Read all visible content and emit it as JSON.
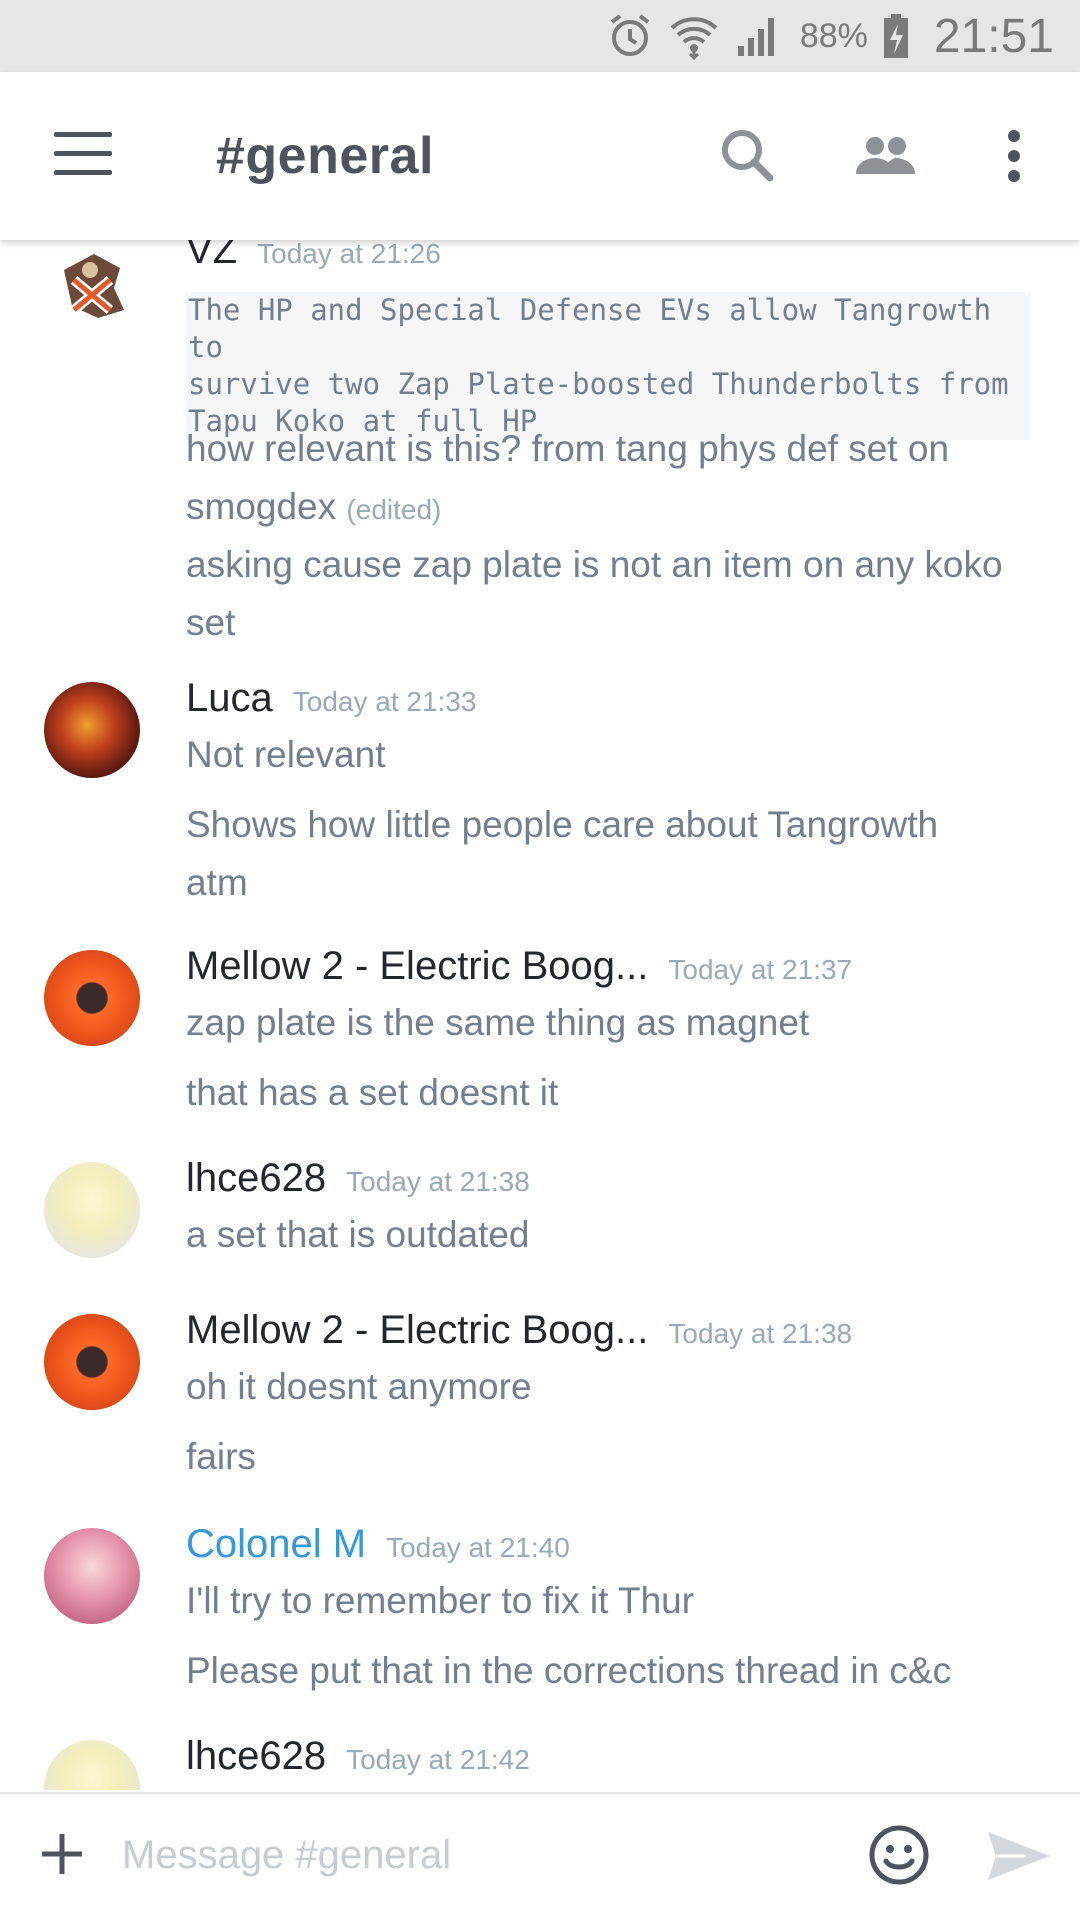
{
  "status_bar": {
    "battery": "88%",
    "time": "21:51",
    "icons": [
      "alarm-icon",
      "wifi-icon",
      "signal-icon",
      "battery-charging-icon"
    ]
  },
  "header": {
    "channel": "#general",
    "icons": [
      "menu-icon",
      "search-icon",
      "members-icon",
      "overflow-icon"
    ]
  },
  "messages": [
    {
      "author": "VZ",
      "timestamp": "Today at 21:26",
      "code": "The HP and Special Defense EVs allow Tangrowth to\nsurvive two Zap Plate-boosted Thunderbolts from\nTapu Koko at full HP",
      "lines": [
        "how relevant is this? from tang phys def set on",
        "smogdex",
        "asking cause zap plate is not an item on any koko",
        "set"
      ],
      "edited": "(edited)"
    },
    {
      "author": "Luca",
      "timestamp": "Today at 21:33",
      "lines": [
        "Not relevant",
        "Shows how little people care about Tangrowth",
        "atm"
      ]
    },
    {
      "author": "Mellow 2 - Electric Boog...",
      "timestamp": "Today at 21:37",
      "lines": [
        "zap plate is the same thing as magnet",
        "that has a set doesnt it"
      ]
    },
    {
      "author": "lhce628",
      "timestamp": "Today at 21:38",
      "lines": [
        "a set that is outdated"
      ]
    },
    {
      "author": "Mellow 2 - Electric Boog...",
      "timestamp": "Today at 21:38",
      "lines": [
        "oh it doesnt anymore",
        "fairs"
      ]
    },
    {
      "author": "Colonel M",
      "timestamp": "Today at 21:40",
      "author_color": "#3498db",
      "lines": [
        "I'll try to remember to fix it Thur",
        "Please put that in the corrections thread in c&c"
      ]
    },
    {
      "author": "lhce628",
      "timestamp": "Today at 21:42",
      "lines": []
    }
  ],
  "composer": {
    "placeholder": "Message #general",
    "icons": [
      "add-icon",
      "emoji-icon",
      "send-icon"
    ]
  },
  "colors": {
    "accent": "#3498db",
    "message_text": "#737f8d",
    "author_text": "#23262a",
    "timestamp_text": "#99aab5"
  }
}
